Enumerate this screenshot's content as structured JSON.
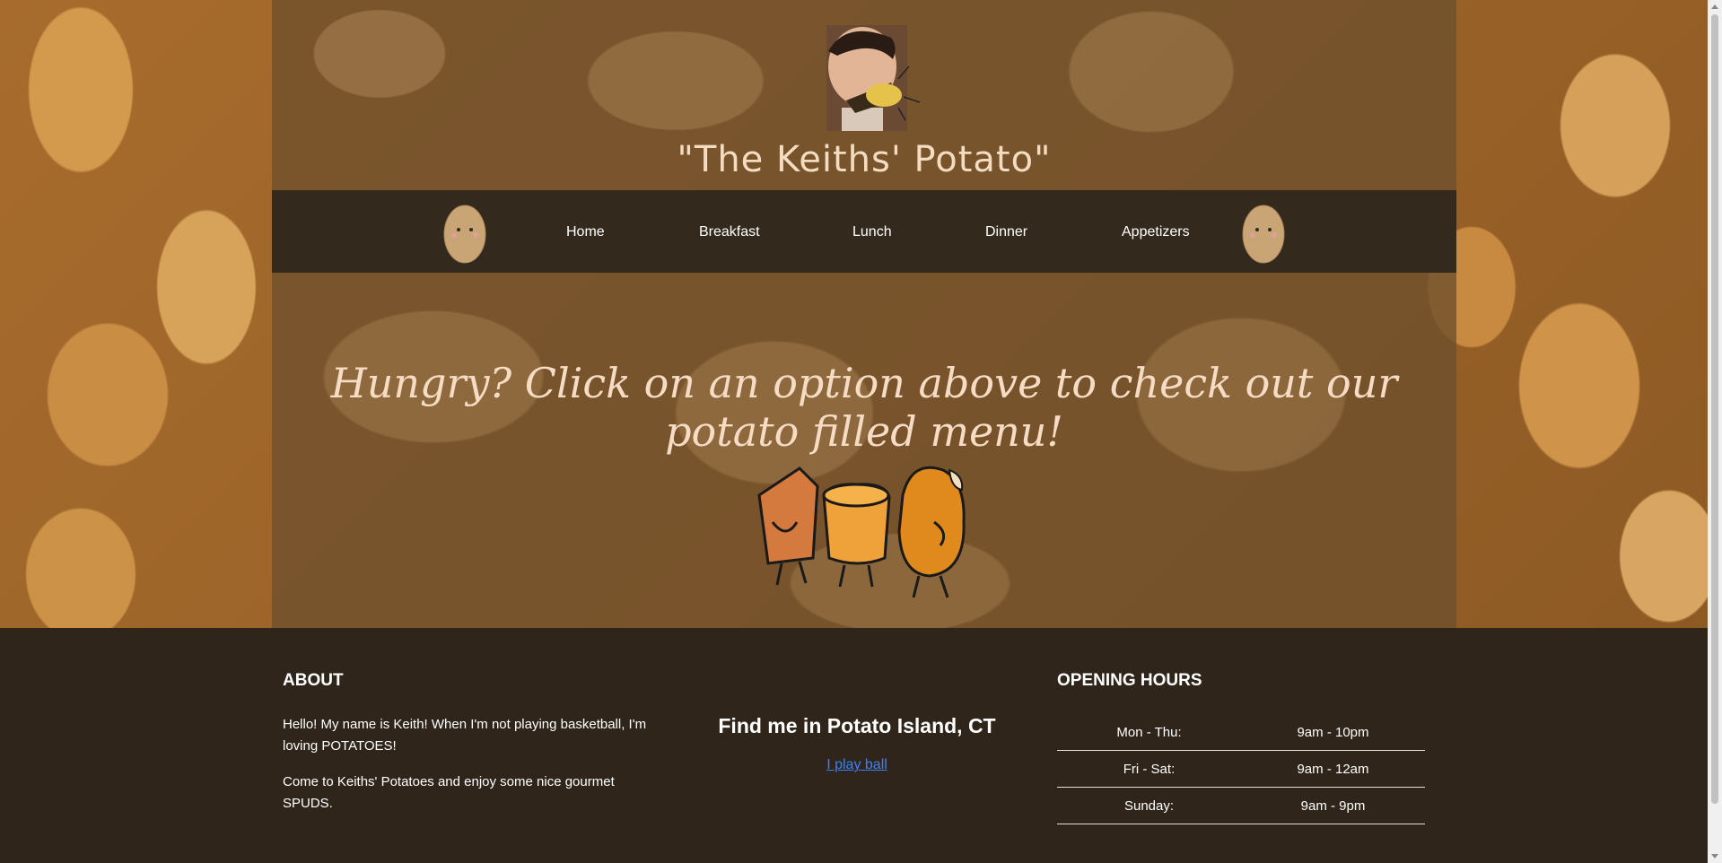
{
  "header": {
    "title": "\"The Keiths' Potato\""
  },
  "nav": {
    "items": [
      "Home",
      "Breakfast",
      "Lunch",
      "Dinner",
      "Appetizers"
    ]
  },
  "hero": {
    "tagline": "Hungry? Click on an option above to check out our potato filled menu!"
  },
  "footer": {
    "about": {
      "heading": "ABOUT",
      "paragraph1": "Hello! My name is Keith! When I'm not playing basketball, I'm loving POTATOES!",
      "paragraph2": "Come to Keiths' Potatoes and enjoy some nice gourmet SPUDS."
    },
    "location": {
      "heading": "Find me in Potato Island, CT",
      "link": "I play ball"
    },
    "hours": {
      "heading": "OPENING HOURS",
      "rows": [
        {
          "days": "Mon - Thu:",
          "time": "9am - 10pm"
        },
        {
          "days": "Fri - Sat:",
          "time": "9am - 12am"
        },
        {
          "days": "Sunday:",
          "time": "9am - 9pm"
        }
      ]
    }
  },
  "colors": {
    "nav_bg": "#33291d",
    "footer_bg": "#2f251b",
    "title_text": "#f4dcc0",
    "link": "#3b82f6"
  }
}
